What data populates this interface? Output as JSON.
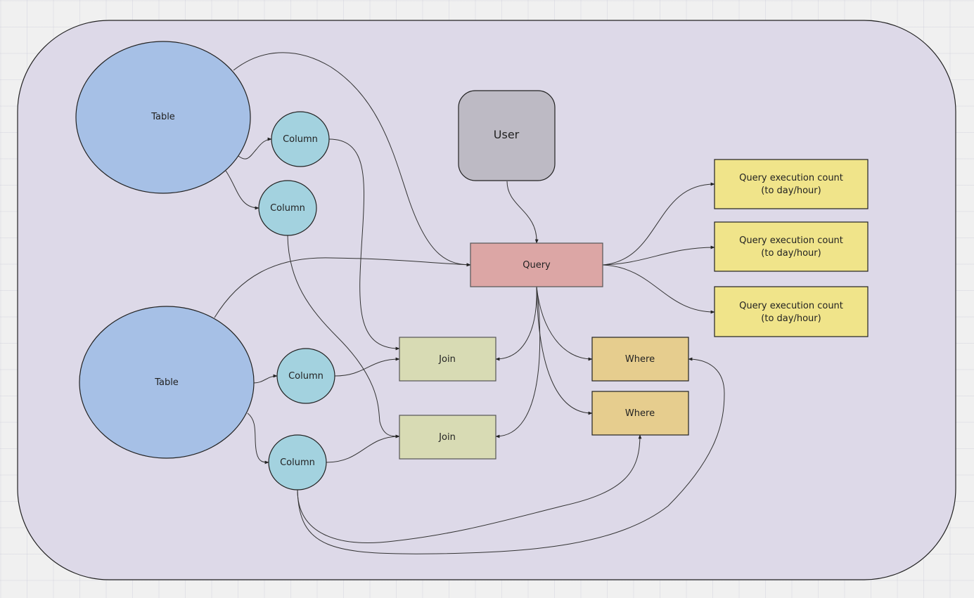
{
  "diagram": {
    "colors": {
      "container": "#ddd9e8",
      "table": "#a6c0e6",
      "column": "#a3d2df",
      "user": "#bdbac4",
      "query": "#dca6a5",
      "metric": "#f0e48a",
      "join": "#d8dbb4",
      "where": "#e6cd8e",
      "edge": "#333333"
    },
    "nodes": {
      "container": {
        "label": "",
        "kind": "container"
      },
      "table1": {
        "label": "Table",
        "kind": "table"
      },
      "table2": {
        "label": "Table",
        "kind": "table"
      },
      "col1a": {
        "label": "Column",
        "kind": "column"
      },
      "col1b": {
        "label": "Column",
        "kind": "column"
      },
      "col2a": {
        "label": "Column",
        "kind": "column"
      },
      "col2b": {
        "label": "Column",
        "kind": "column"
      },
      "user": {
        "label": "User",
        "kind": "user"
      },
      "query": {
        "label": "Query",
        "kind": "query"
      },
      "metric1": {
        "label": "Query execution count",
        "sublabel": "(to day/hour)",
        "kind": "metric"
      },
      "metric2": {
        "label": "Query execution count",
        "sublabel": "(to day/hour)",
        "kind": "metric"
      },
      "metric3": {
        "label": "Query execution count",
        "sublabel": "(to day/hour)",
        "kind": "metric"
      },
      "join1": {
        "label": "Join",
        "kind": "join"
      },
      "join2": {
        "label": "Join",
        "kind": "join"
      },
      "where1": {
        "label": "Where",
        "kind": "where"
      },
      "where2": {
        "label": "Where",
        "kind": "where"
      }
    },
    "edges": [
      {
        "from": "table1",
        "to": "col1a"
      },
      {
        "from": "table1",
        "to": "col1b"
      },
      {
        "from": "table1",
        "to": "query"
      },
      {
        "from": "table2",
        "to": "query"
      },
      {
        "from": "table2",
        "to": "col2a"
      },
      {
        "from": "table2",
        "to": "col2b"
      },
      {
        "from": "user",
        "to": "query"
      },
      {
        "from": "query",
        "to": "metric1"
      },
      {
        "from": "query",
        "to": "metric2"
      },
      {
        "from": "query",
        "to": "metric3"
      },
      {
        "from": "query",
        "to": "join1"
      },
      {
        "from": "query",
        "to": "join2"
      },
      {
        "from": "query",
        "to": "where1"
      },
      {
        "from": "query",
        "to": "where2"
      },
      {
        "from": "col1a",
        "to": "join1"
      },
      {
        "from": "col2a",
        "to": "join1"
      },
      {
        "from": "col1b",
        "to": "join2"
      },
      {
        "from": "col2b",
        "to": "join2"
      },
      {
        "from": "col2b",
        "to": "where2"
      },
      {
        "from": "col2b",
        "to": "where1"
      }
    ]
  }
}
